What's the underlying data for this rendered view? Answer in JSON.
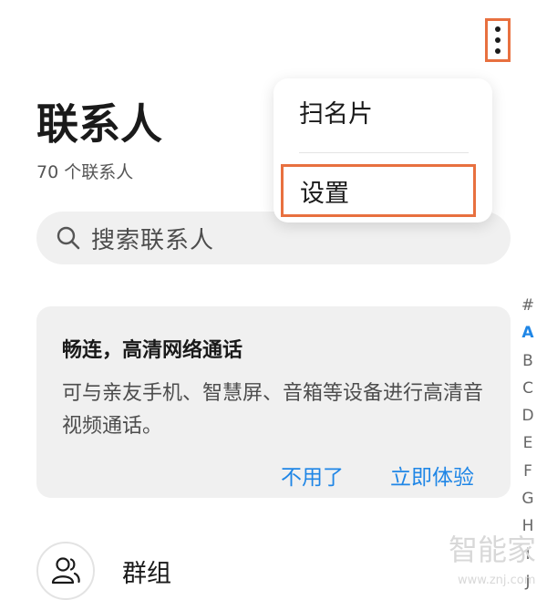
{
  "header": {
    "title": "联系人",
    "subtitle": "70 个联系人",
    "more_icon": "more-vertical-icon"
  },
  "search": {
    "placeholder": "搜索联系人",
    "icon": "search-icon"
  },
  "menu": {
    "items": [
      {
        "label": "扫名片"
      },
      {
        "label": "设置"
      }
    ]
  },
  "card": {
    "title": "畅连，高清网络通话",
    "body": "可与亲友手机、智慧屏、音箱等设备进行高清音视频通话。",
    "dismiss_label": "不用了",
    "try_label": "立即体验"
  },
  "alphabet": {
    "letters": [
      "#",
      "A",
      "B",
      "C",
      "D",
      "E",
      "F",
      "G",
      "H",
      "I",
      "J"
    ],
    "active": "A"
  },
  "group": {
    "label": "群组",
    "icon": "group-icon"
  },
  "watermark": {
    "text": "智能家",
    "url": "www.znj.com"
  },
  "colors": {
    "accent": "#1f86e6",
    "highlight_border": "#e8703f",
    "card_bg": "#f0f0f0"
  }
}
